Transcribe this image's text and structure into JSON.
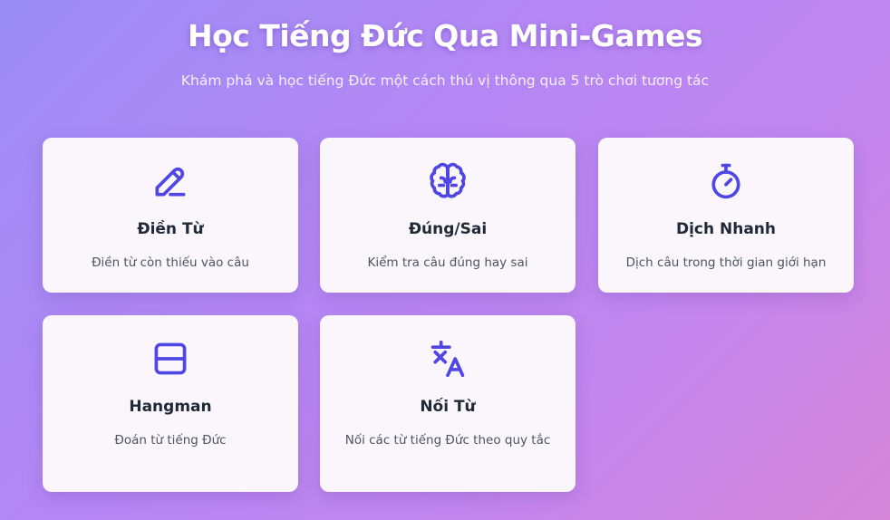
{
  "header": {
    "title": "Học Tiếng Đức Qua Mini-Games",
    "subtitle": "Khám phá và học tiếng Đức một cách thú vị thông qua 5 trò chơi tương tác"
  },
  "colors": {
    "accent": "#4f46e5",
    "card_bg": "#faf6fc",
    "title_text": "#ffffff"
  },
  "games": [
    {
      "icon": "pencil-icon",
      "title": "Điền Từ",
      "description": "Điền từ còn thiếu vào câu"
    },
    {
      "icon": "brain-icon",
      "title": "Đúng/Sai",
      "description": "Kiểm tra câu đúng hay sai"
    },
    {
      "icon": "stopwatch-icon",
      "title": "Dịch Nhanh",
      "description": "Dịch câu trong thời gian giới hạn"
    },
    {
      "icon": "hangman-box-icon",
      "title": "Hangman",
      "description": "Đoán từ tiếng Đức"
    },
    {
      "icon": "translate-icon",
      "title": "Nối Từ",
      "description": "Nối các từ tiếng Đức theo quy tắc"
    }
  ]
}
